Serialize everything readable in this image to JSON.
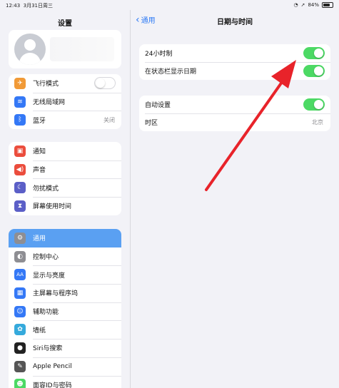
{
  "status": {
    "time": "12:43",
    "date": "3月31日周三",
    "battery": "84%"
  },
  "sidebar": {
    "title": "设置",
    "group1": [
      {
        "label": "飞行模式",
        "icon": "airplane-icon",
        "color": "#f19a37"
      },
      {
        "label": "无线局域网",
        "icon": "wifi-icon",
        "color": "#3478f6"
      },
      {
        "label": "蓝牙",
        "icon": "bluetooth-icon",
        "color": "#3478f6",
        "value": "关闭"
      }
    ],
    "group2": [
      {
        "label": "通知",
        "icon": "notification-icon",
        "color": "#eb4d3d"
      },
      {
        "label": "声音",
        "icon": "sound-icon",
        "color": "#eb4d3d"
      },
      {
        "label": "勿扰模式",
        "icon": "moon-icon",
        "color": "#5b5fc7"
      },
      {
        "label": "屏幕使用时间",
        "icon": "hourglass-icon",
        "color": "#5b5fc7"
      }
    ],
    "group3": [
      {
        "label": "通用",
        "icon": "gear-icon",
        "color": "#8e8e93"
      },
      {
        "label": "控制中心",
        "icon": "toggles-icon",
        "color": "#8e8e93"
      },
      {
        "label": "显示与亮度",
        "icon": "aa-icon",
        "color": "#3478f6"
      },
      {
        "label": "主屏幕与程序坞",
        "icon": "grid-icon",
        "color": "#3478f6"
      },
      {
        "label": "辅助功能",
        "icon": "accessibility-icon",
        "color": "#3478f6"
      },
      {
        "label": "墙纸",
        "icon": "wallpaper-icon",
        "color": "#35aadc"
      },
      {
        "label": "Siri与搜索",
        "icon": "siri-icon",
        "color": "#222222"
      },
      {
        "label": "Apple Pencil",
        "icon": "pencil-icon",
        "color": "#555555"
      },
      {
        "label": "面容ID与密码",
        "icon": "faceid-icon",
        "color": "#4cd964"
      }
    ]
  },
  "main": {
    "back_label": "通用",
    "title": "日期与时间",
    "group1": [
      {
        "label": "24小时制",
        "toggle": "on"
      },
      {
        "label": "在状态栏显示日期",
        "toggle": "on"
      }
    ],
    "group2": [
      {
        "label": "自动设置",
        "toggle": "on"
      },
      {
        "label": "时区",
        "value": "北京"
      }
    ]
  },
  "colors": {
    "accent": "#2f7bf5",
    "toggle_on": "#4cd964",
    "selected": "#5aa0f2",
    "arrow": "#e8232a"
  }
}
